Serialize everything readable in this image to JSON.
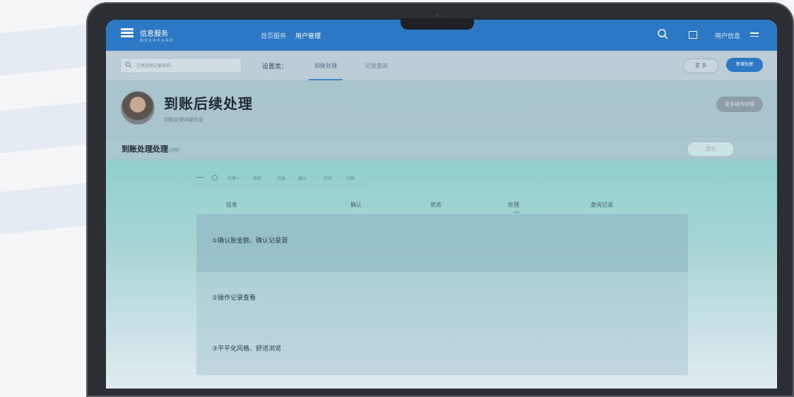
{
  "app": {
    "title": "信息服务",
    "subtitle": "服务支持平台系统"
  },
  "nav": {
    "items": [
      {
        "label": "首页服务",
        "active": false
      },
      {
        "label": "用户管理",
        "active": true
      }
    ]
  },
  "topbar": {
    "user": "用户信息",
    "icons": [
      "search-icon",
      "window-icon",
      "menu-icon"
    ]
  },
  "toolbar": {
    "search_placeholder": "已承处理记录查询...",
    "filter_label": "设置类：",
    "tabs": [
      {
        "label": "到账处理",
        "active": true
      },
      {
        "label": "记录查询",
        "active": false
      }
    ],
    "outline_button": "更 多",
    "primary_button": "新增处理"
  },
  "header": {
    "title": "到账后续处理",
    "subtitle": "到账处理详细信息",
    "action_button": "更多操作详情"
  },
  "section": {
    "title": "到账处理处理",
    "title_note": "(详情)",
    "button": "提交"
  },
  "steps": [
    "步骤一",
    "审核",
    "记录",
    "确认",
    "完成",
    "归档"
  ],
  "table": {
    "columns": [
      "信息",
      "确认",
      "状态",
      "处理",
      "查询记录"
    ],
    "rows": [
      "①确认账金额、确认记录源",
      "②操作记录查看",
      "③平平化风格、舒适浏览"
    ]
  },
  "colors": {
    "primary": "#2c78c4",
    "header_bg": "#bccdd6",
    "teal": "#8fcfcc"
  }
}
